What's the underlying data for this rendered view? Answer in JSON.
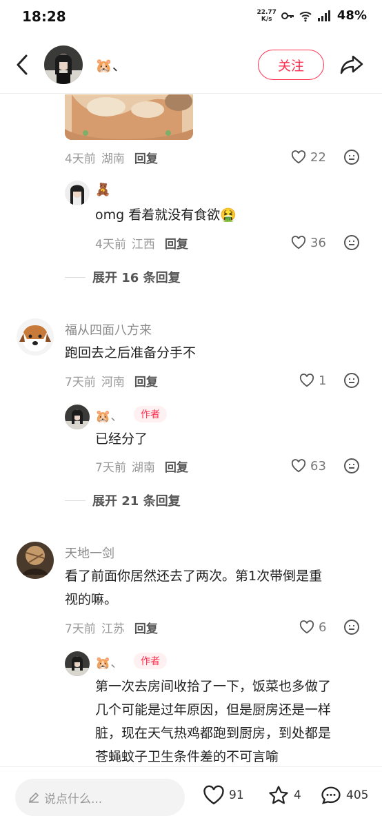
{
  "status": {
    "time": "18:28",
    "net_speed_value": "22.77",
    "net_speed_unit": "K/s",
    "battery": "48%"
  },
  "header": {
    "author_name": "🐹、",
    "follow_label": "关注"
  },
  "comments": [
    {
      "time": "4天前",
      "location": "湖南",
      "reply_label": "回复",
      "likes": "22",
      "replies": [
        {
          "username": "🧸",
          "text": "omg 看着就没有食欲🤮",
          "time": "4天前",
          "location": "江西",
          "reply_label": "回复",
          "likes": "36"
        }
      ],
      "expand_label": "展开 16 条回复"
    },
    {
      "username": "福从四面八方来",
      "text": "跑回去之后准备分手不",
      "time": "7天前",
      "location": "河南",
      "reply_label": "回复",
      "likes": "1",
      "replies": [
        {
          "username": "🐹、",
          "author_tag": "作者",
          "text": "已经分了",
          "time": "7天前",
          "location": "湖南",
          "reply_label": "回复",
          "likes": "63"
        }
      ],
      "expand_label": "展开 21 条回复"
    },
    {
      "username": "天地一剑",
      "text_line1": "看了前面你居然还去了两次。第1次带倒是重",
      "text_line2": "视的嘛。",
      "time": "7天前",
      "location": "江苏",
      "reply_label": "回复",
      "likes": "6",
      "replies": [
        {
          "username": "🐹、",
          "author_tag": "作者",
          "text_line1": "第一次去房间收拾了一下，饭菜也多做了",
          "text_line2": "几个可能是过年原因，但是厨房还是一样",
          "text_line3": "脏，现在天气热鸡都跑到厨房，到处都是",
          "text_line4": "苍蝇蚊子卫生条件差的不可言喻"
        }
      ]
    }
  ],
  "bottom_bar": {
    "input_placeholder": "说点什么...",
    "like_count": "91",
    "collect_count": "4",
    "comment_count": "405"
  },
  "colors": {
    "accent": "#ff2e4d",
    "meta_gray": "#999999"
  }
}
